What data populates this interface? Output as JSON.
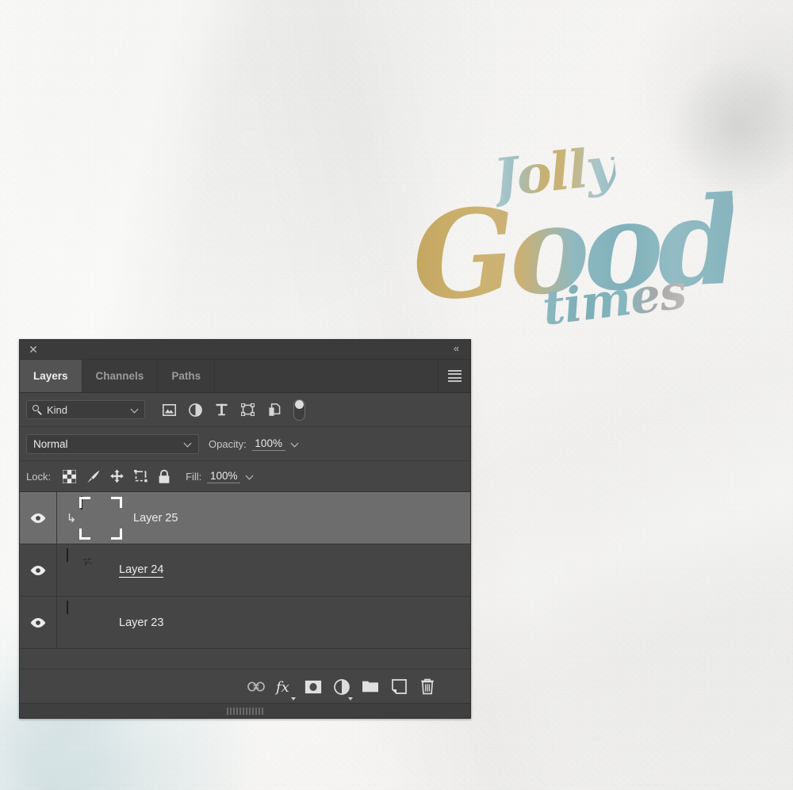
{
  "artwork": {
    "line1": "Jolly",
    "line2": "Good",
    "line3": "times",
    "colors": {
      "gold": "#c8b072",
      "teal": "#8fb9c1",
      "grey": "#a9a8a6"
    }
  },
  "panel": {
    "close_icon": "close-icon",
    "collapse_icon": "collapse-double-chevron-icon",
    "collapse_glyph": "«",
    "close_glyph": "✕",
    "menu_icon": "panel-menu-hamburger-icon",
    "colors": {
      "panel_bg": "#454545",
      "tabbar_bg": "#3b3b3b",
      "active_tab_bg": "#535353",
      "selected_row_bg": "#6d6d6d",
      "text": "#ececec",
      "field_bg": "#3c3c3c",
      "border": "#2b2b2b"
    },
    "tabs": [
      {
        "label": "Layers",
        "active": true
      },
      {
        "label": "Channels",
        "active": false
      },
      {
        "label": "Paths",
        "active": false
      }
    ],
    "filter_row": {
      "kind_label": "Kind",
      "search_icon": "magnifier-icon",
      "dropdown_icon": "chevron-down-icon",
      "icons": [
        {
          "name": "filter-pixel-layers-icon",
          "title": "Pixel layers"
        },
        {
          "name": "filter-adjustment-layers-icon",
          "title": "Adjustment layers"
        },
        {
          "name": "filter-type-layers-icon",
          "title": "Type layers"
        },
        {
          "name": "filter-shape-layers-icon",
          "title": "Shape layers"
        },
        {
          "name": "filter-smart-object-layers-icon",
          "title": "Smart objects"
        }
      ],
      "toggle": {
        "name": "filter-enable-toggle",
        "state": "on"
      }
    },
    "blend_row": {
      "blend_mode": "Normal",
      "opacity_label": "Opacity:",
      "opacity_value": "100%",
      "dropdown_icon": "chevron-down-icon"
    },
    "lock_row": {
      "lock_label": "Lock:",
      "icons": [
        {
          "name": "lock-transparent-pixels-icon",
          "glyph": "checkerboard"
        },
        {
          "name": "lock-image-pixels-icon",
          "glyph": "paintbrush"
        },
        {
          "name": "lock-position-icon",
          "glyph": "move-arrows"
        },
        {
          "name": "lock-artboard-nesting-icon",
          "glyph": "artboard"
        },
        {
          "name": "lock-all-icon",
          "glyph": "padlock"
        }
      ],
      "fill_label": "Fill:",
      "fill_value": "100%"
    },
    "layers": [
      {
        "name": "Layer 25",
        "visible": true,
        "selected": true,
        "clipped": true,
        "renaming": false,
        "thumb": "artwork",
        "eye_icon": "eye-visible-icon",
        "clip_icon": "clipping-mask-arrow-icon"
      },
      {
        "name": "Layer 24",
        "visible": true,
        "selected": false,
        "clipped": false,
        "renaming": true,
        "thumb": "transparent-scribble",
        "eye_icon": "eye-visible-icon"
      },
      {
        "name": "Layer 23",
        "visible": true,
        "selected": false,
        "clipped": false,
        "renaming": false,
        "thumb": "paper",
        "eye_icon": "eye-visible-icon"
      }
    ],
    "bottom_toolbar": [
      {
        "name": "link-layers-button",
        "icon": "link-icon",
        "has_caret": false
      },
      {
        "name": "layer-style-button",
        "icon": "fx-icon",
        "label": "fx",
        "has_caret": true
      },
      {
        "name": "add-layer-mask-button",
        "icon": "layer-mask-icon",
        "has_caret": false
      },
      {
        "name": "new-adjustment-layer-button",
        "icon": "half-circle-icon",
        "has_caret": true
      },
      {
        "name": "new-group-button",
        "icon": "folder-icon",
        "has_caret": false
      },
      {
        "name": "new-layer-button",
        "icon": "new-layer-page-icon",
        "has_caret": false
      },
      {
        "name": "delete-layer-button",
        "icon": "trash-icon",
        "has_caret": false
      }
    ]
  }
}
